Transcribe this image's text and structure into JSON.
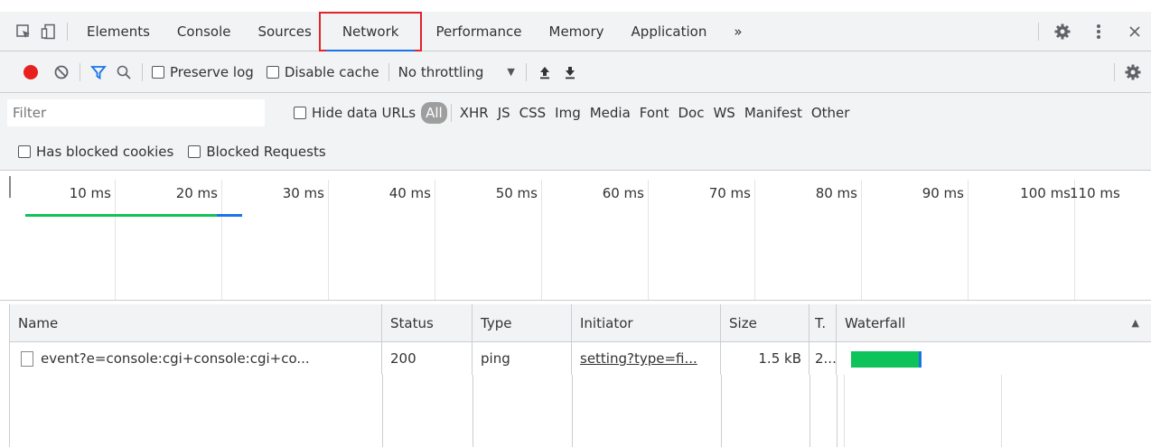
{
  "tabs": [
    "Elements",
    "Console",
    "Sources",
    "Network",
    "Performance",
    "Memory",
    "Application"
  ],
  "tabs_overflow": "»",
  "toolbar": {
    "preserve_log": "Preserve log",
    "disable_cache": "Disable cache",
    "throttling": "No throttling",
    "select_arrow": "▼"
  },
  "filter": {
    "placeholder": "Filter",
    "hide_data_urls": "Hide data URLs",
    "types": [
      "All",
      "XHR",
      "JS",
      "CSS",
      "Img",
      "Media",
      "Font",
      "Doc",
      "WS",
      "Manifest",
      "Other"
    ]
  },
  "blocked": {
    "has_blocked_cookies": "Has blocked cookies",
    "blocked_requests": "Blocked Requests"
  },
  "overview": {
    "ticks": [
      "10 ms",
      "20 ms",
      "30 ms",
      "40 ms",
      "50 ms",
      "60 ms",
      "70 ms",
      "80 ms",
      "90 ms",
      "100 ms",
      "110 ms"
    ]
  },
  "table": {
    "headers": {
      "name": "Name",
      "status": "Status",
      "type": "Type",
      "initiator": "Initiator",
      "size": "Size",
      "time": "T.",
      "waterfall": "Waterfall",
      "sort_arrow": "▲"
    },
    "rows": [
      {
        "name": "event?e=console:cgi+console:cgi+co...",
        "status": "200",
        "type": "ping",
        "initiator": "setting?type=fi...",
        "size": "1.5 kB",
        "time": "2..."
      }
    ]
  },
  "colors": {
    "record": "#e8211f",
    "accent": "#1a73e8",
    "waterfall": "#0fc35b",
    "highlight": "#e0242a"
  }
}
